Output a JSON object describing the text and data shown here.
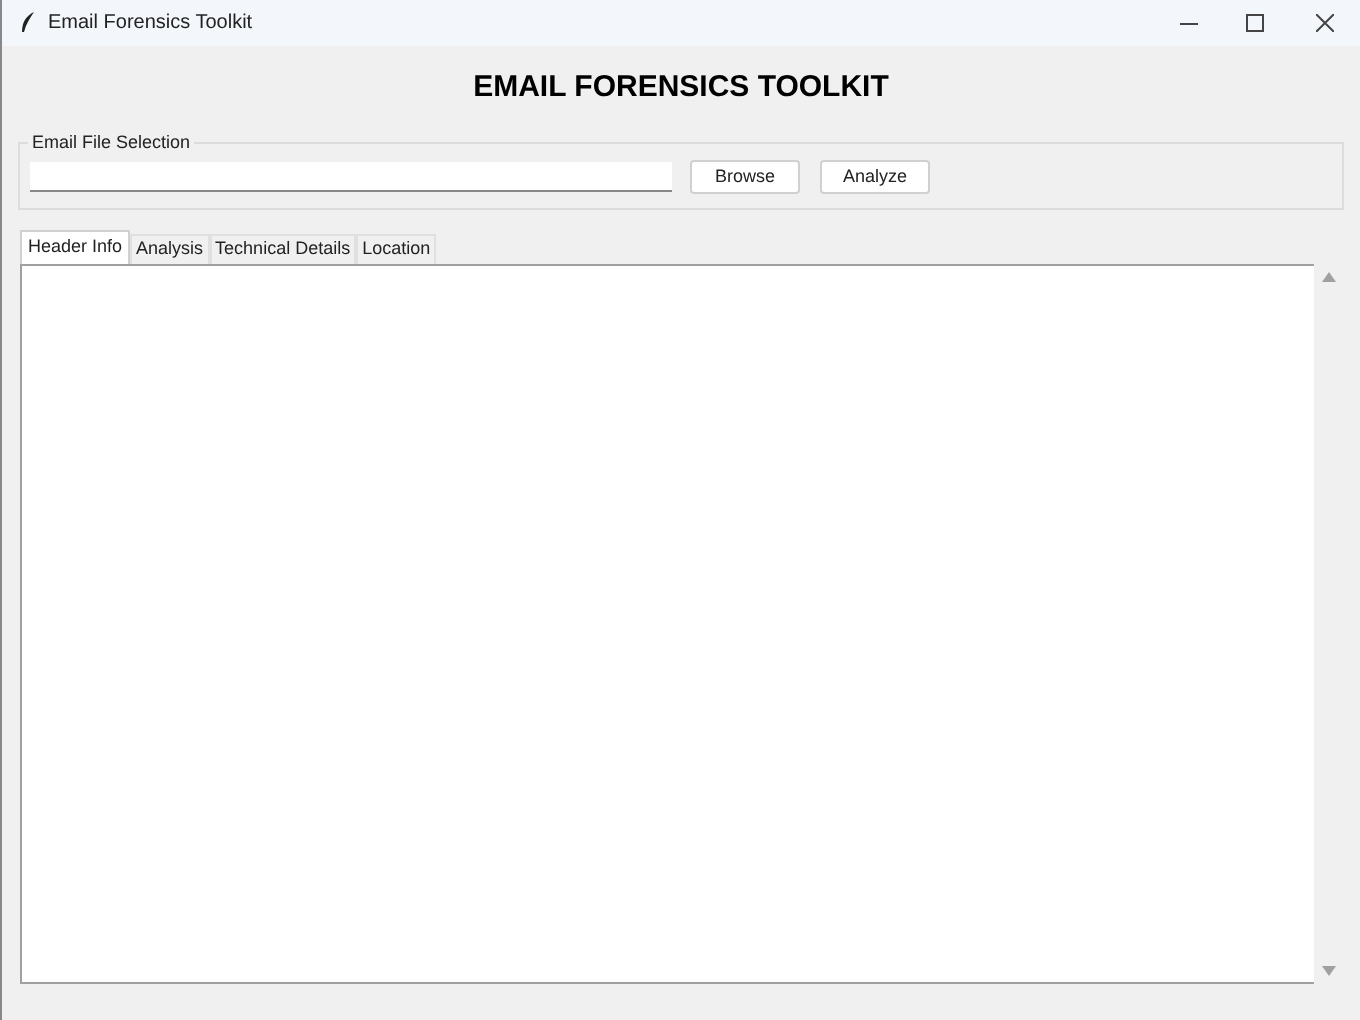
{
  "window": {
    "title": "Email Forensics Toolkit"
  },
  "heading": "EMAIL FORENSICS TOOLKIT",
  "file_selection": {
    "label": "Email File Selection",
    "buttons": [
      "Browse",
      "Analyze"
    ]
  },
  "tabs": [
    {
      "label": "Header Info",
      "selected": true
    },
    {
      "label": "Analysis",
      "selected": false
    },
    {
      "label": "Technical Details",
      "selected": false
    },
    {
      "label": "Location",
      "selected": false
    }
  ]
}
